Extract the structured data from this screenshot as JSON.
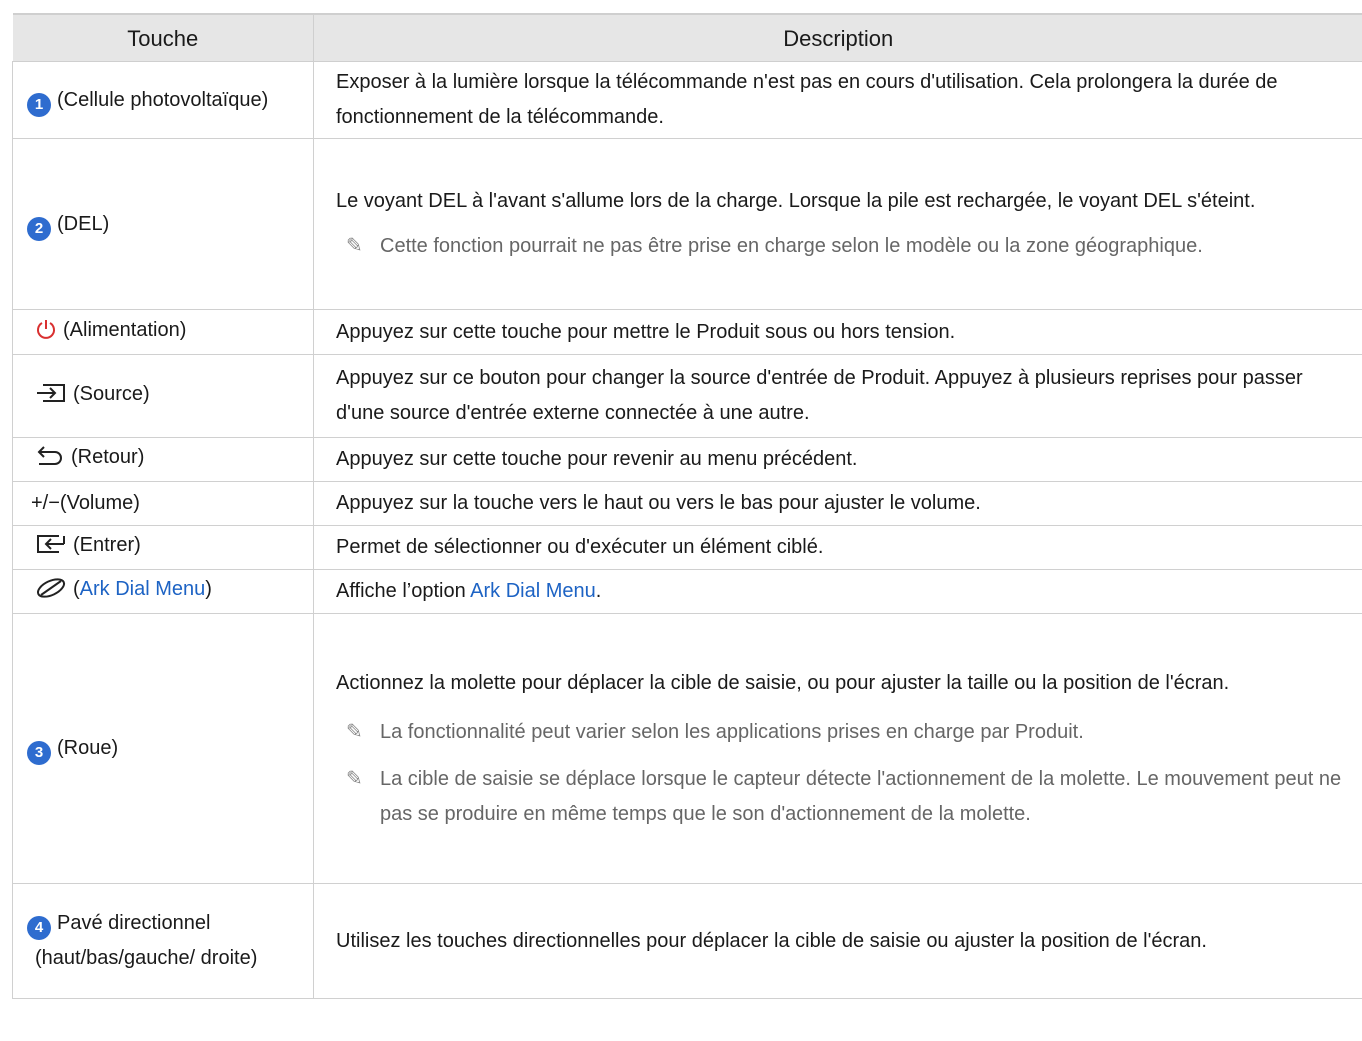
{
  "header": {
    "col_key": "Touche",
    "col_desc": "Description"
  },
  "rows": [
    {
      "badge": "1",
      "key": "(Cellule photovoltaïque)",
      "desc": "Exposer à la lumière lorsque la télécommande n'est pas en cours d'utilisation. Cela prolongera la durée de fonctionnement de la télécommande."
    },
    {
      "badge": "2",
      "key": "(DEL)",
      "desc": "Le voyant DEL à l'avant s'allume lors de la charge. Lorsque la pile est rechargée, le voyant DEL s'éteint.",
      "notes": [
        "Cette fonction pourrait ne pas être prise en charge selon le modèle ou la zone géographique."
      ]
    },
    {
      "icon": "power-icon",
      "key": "(Alimentation)",
      "desc": "Appuyez sur cette touche pour mettre le Produit sous ou hors tension."
    },
    {
      "icon": "source-icon",
      "key": "(Source)",
      "desc": "Appuyez sur ce bouton pour changer la source d'entrée de Produit. Appuyez à plusieurs reprises pour passer d'une source d'entrée externe connectée à une autre."
    },
    {
      "icon": "return-icon",
      "key": "(Retour)",
      "desc": "Appuyez sur cette touche pour revenir au menu précédent."
    },
    {
      "icon": "volume-icon",
      "key": "+/−(Volume)",
      "desc": "Appuyez sur la touche vers le haut ou vers le bas pour ajuster le volume."
    },
    {
      "icon": "enter-icon",
      "key": "(Entrer)",
      "desc": "Permet de sélectionner ou d'exécuter un élément ciblé."
    },
    {
      "icon": "ark-dial-icon",
      "key_prefix": "(",
      "key_link": "Ark Dial Menu",
      "key_suffix": ")",
      "desc_prefix": "Affiche l’option ",
      "desc_link": "Ark Dial Menu",
      "desc_suffix": "."
    },
    {
      "badge": "3",
      "key": "(Roue)",
      "desc": "Actionnez la molette pour déplacer la cible de saisie, ou pour ajuster la taille ou la position de l'écran.",
      "notes": [
        "La fonctionnalité peut varier selon les applications prises en charge par Produit.",
        "La cible de saisie se déplace lorsque le capteur détecte l'actionnement de la molette. Le mouvement peut ne pas se produire en même temps que le son d'actionnement de la molette."
      ]
    },
    {
      "badge": "4",
      "key": "Pavé directionnel (haut/bas/gauche/ droite)",
      "desc": "Utilisez les touches directionnelles pour déplacer la cible de saisie ou ajuster la position de l'écran."
    }
  ],
  "colors": {
    "badge": "#2e6ccf",
    "link": "#1d63c4",
    "power": "#d93030",
    "header_bg": "#e6e6e6"
  }
}
